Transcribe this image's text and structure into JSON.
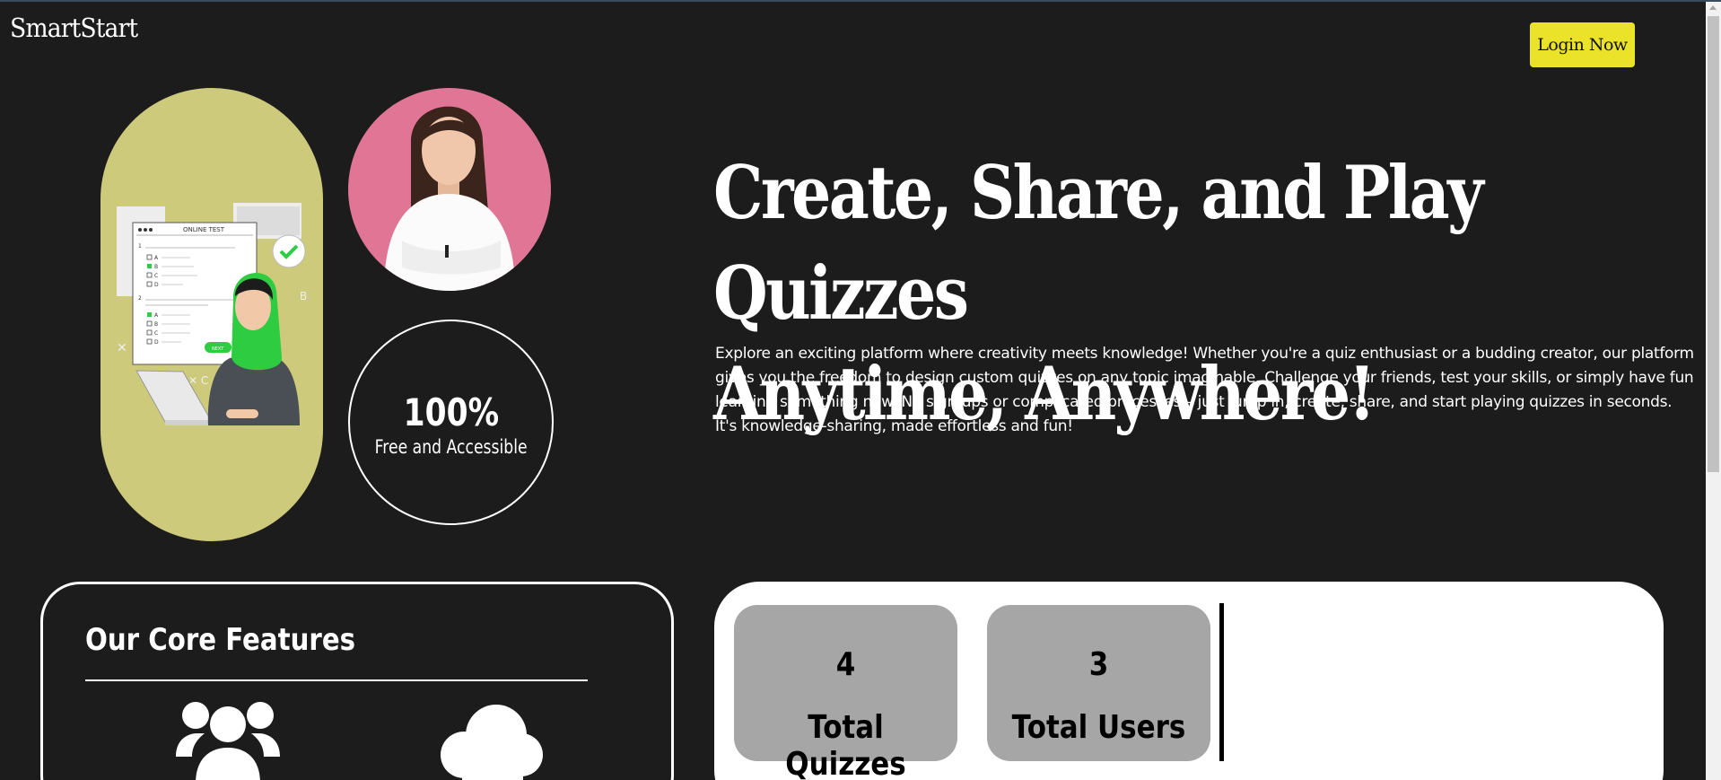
{
  "header": {
    "brand": "SmartStart",
    "login_label": "Login Now"
  },
  "hero": {
    "title_line1": "Create, Share, and Play Quizzes",
    "title_line2": "Anytime, Anywhere!",
    "description": "Explore an exciting platform where creativity meets knowledge! Whether you're a quiz enthusiast or a budding creator, our platform gives you the freedom to design custom quizzes on any topic imaginable. Challenge your friends, test your skills, or simply have fun learning something new. No sign-ups or complicated processes – just jump in, create, share, and start playing quizzes in seconds. It's knowledge-sharing, made effortless and fun!",
    "illustration": {
      "sheet_title": "ONLINE TEST",
      "options_q1": [
        "A",
        "B",
        "C",
        "D"
      ],
      "options_q2": [
        "A",
        "B",
        "C",
        "D"
      ],
      "next_label": "NEXT",
      "letters": [
        "A",
        "B",
        "C"
      ]
    },
    "badge": {
      "value": "100%",
      "label": "Free and Accessible"
    }
  },
  "features": {
    "title": "Our Core Features",
    "icons": [
      "users-icon",
      "cloud-icon"
    ]
  },
  "stats": [
    {
      "value": "4",
      "label": "Total Quizzes"
    },
    {
      "value": "3",
      "label": "Total Users"
    }
  ],
  "colors": {
    "background": "#1c1c1c",
    "accent_yellow": "#eae32a",
    "pill_green": "#cdcb7b",
    "portrait_pink": "#e07596",
    "stat_grey": "#a6a6a6"
  }
}
